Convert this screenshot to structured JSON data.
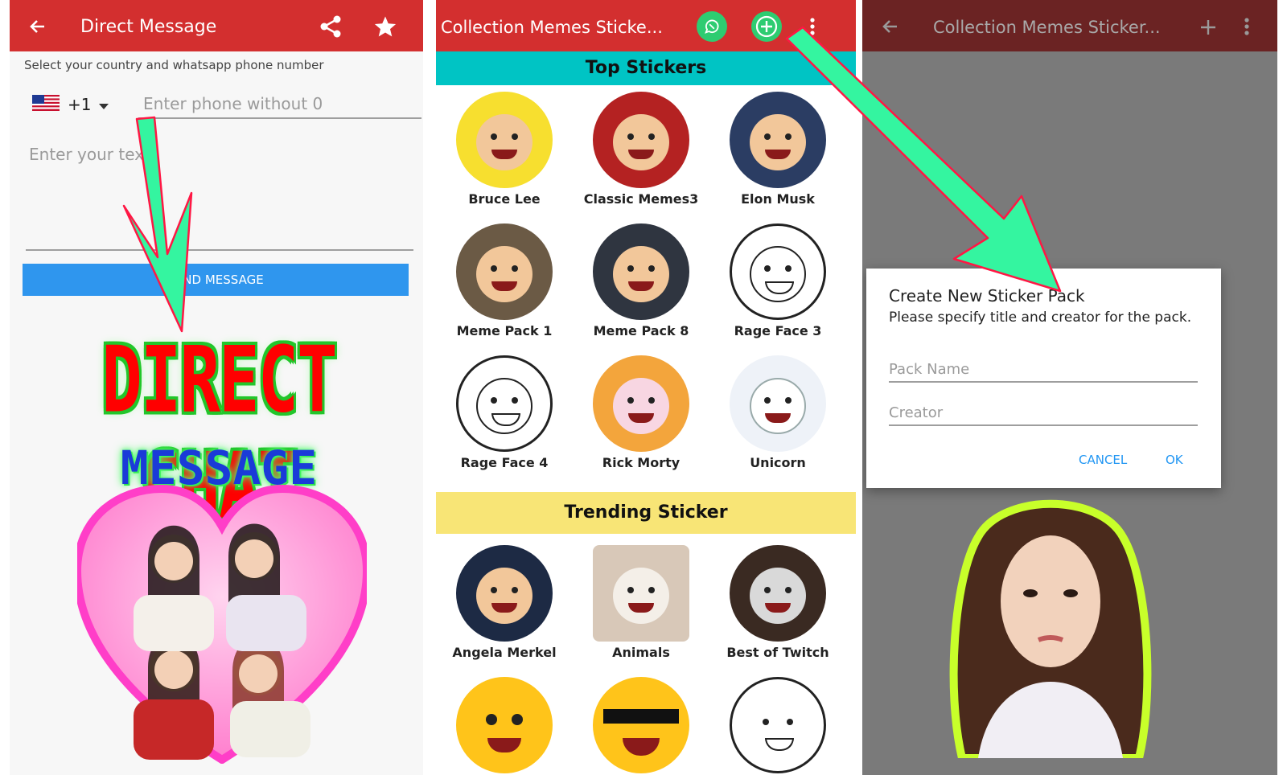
{
  "panel1": {
    "appbar": {
      "title": "Direct Message",
      "back_icon": "arrow-left-icon",
      "share_icon": "share-icon",
      "star_icon": "star-icon"
    },
    "hint": "Select your country and whatsapp phone number",
    "country_code": "+1",
    "phone_placeholder": "Enter phone without 0",
    "text_placeholder": "Enter your text",
    "send_label": "SEND MESSAGE",
    "promo_title": "DIRECT CHAT",
    "promo_subtitle": "MESSAGE"
  },
  "panel2": {
    "appbar": {
      "title": "Collection Memes Sticke...",
      "whatsapp_icon": "whatsapp-icon",
      "add_icon": "plus-circle-icon",
      "menu_icon": "more-vertical-icon"
    },
    "top_section": "Top Stickers",
    "top_stickers": [
      {
        "label": "Bruce Lee"
      },
      {
        "label": "Classic Memes3"
      },
      {
        "label": "Elon Musk"
      },
      {
        "label": "Meme Pack 1"
      },
      {
        "label": "Meme Pack 8"
      },
      {
        "label": "Rage Face 3"
      },
      {
        "label": "Rage Face 4"
      },
      {
        "label": "Rick Morty"
      },
      {
        "label": "Unicorn"
      }
    ],
    "trending_section": "Trending Sticker",
    "trending_stickers": [
      {
        "label": "Angela Merkel"
      },
      {
        "label": "Animals"
      },
      {
        "label": "Best of Twitch"
      },
      {
        "label": ""
      },
      {
        "label": ""
      },
      {
        "label": ""
      }
    ]
  },
  "panel3": {
    "appbar": {
      "title": "Collection Memes Sticker...",
      "back_icon": "arrow-left-icon",
      "add_icon": "plus-icon",
      "menu_icon": "more-vertical-icon"
    },
    "dialog": {
      "title": "Create New Sticker Pack",
      "subtitle": "Please specify title and creator for the pack.",
      "pack_name_placeholder": "Pack Name",
      "creator_placeholder": "Creator",
      "cancel_label": "CANCEL",
      "ok_label": "OK"
    }
  },
  "colors": {
    "appbar_red": "#d32f2f",
    "top_section_bg": "#00c4c4",
    "trending_section_bg": "#f8e576",
    "send_button_blue": "#2f96ee",
    "arrow_green": "#34f5a0",
    "dialog_button_blue": "#2196f3"
  }
}
